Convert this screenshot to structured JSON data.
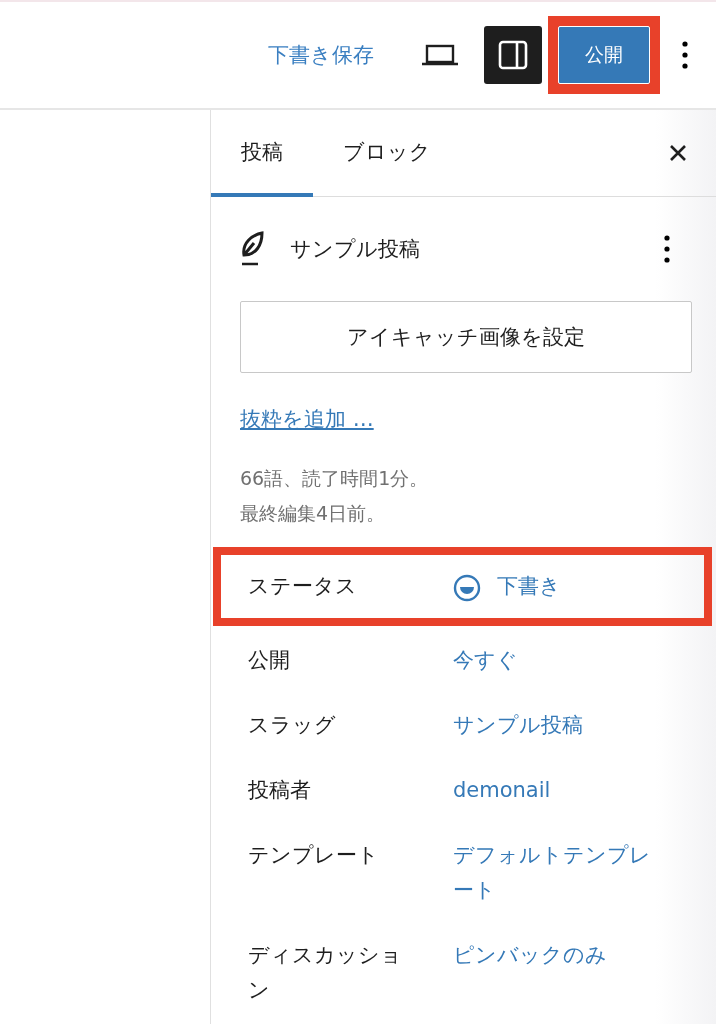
{
  "toolbar": {
    "save_draft": "下書き保存",
    "sidebar_toggle": {
      "on": true
    },
    "publish": {
      "label": "公開",
      "highlighted": true
    }
  },
  "sidebar": {
    "tabs": [
      {
        "label": "投稿",
        "selected": true
      },
      {
        "label": "ブロック",
        "selected": false
      }
    ],
    "post_title": "サンプル投稿",
    "featured_image_button": "アイキャッチ画像を設定",
    "excerpt_link": "抜粋を追加 …",
    "stats": [
      "66語、読了時間1分。",
      "最終編集4日前。"
    ],
    "rows": [
      {
        "label": "ステータス",
        "value": "下書き",
        "kind": "status",
        "highlighted": true
      },
      {
        "label": "公開",
        "value": "今すぐ",
        "kind": "plain",
        "highlighted": false
      },
      {
        "label": "スラッグ",
        "value": "サンプル投稿",
        "kind": "plain",
        "highlighted": false
      },
      {
        "label": "投稿者",
        "value": "demonail",
        "kind": "plain",
        "highlighted": false
      },
      {
        "label": "テンプレート",
        "value": "デフォルトテンプレート",
        "kind": "plain",
        "highlighted": false
      },
      {
        "label": "ディスカッション",
        "value": "ピンバックのみ",
        "kind": "plain",
        "highlighted": false
      }
    ]
  }
}
